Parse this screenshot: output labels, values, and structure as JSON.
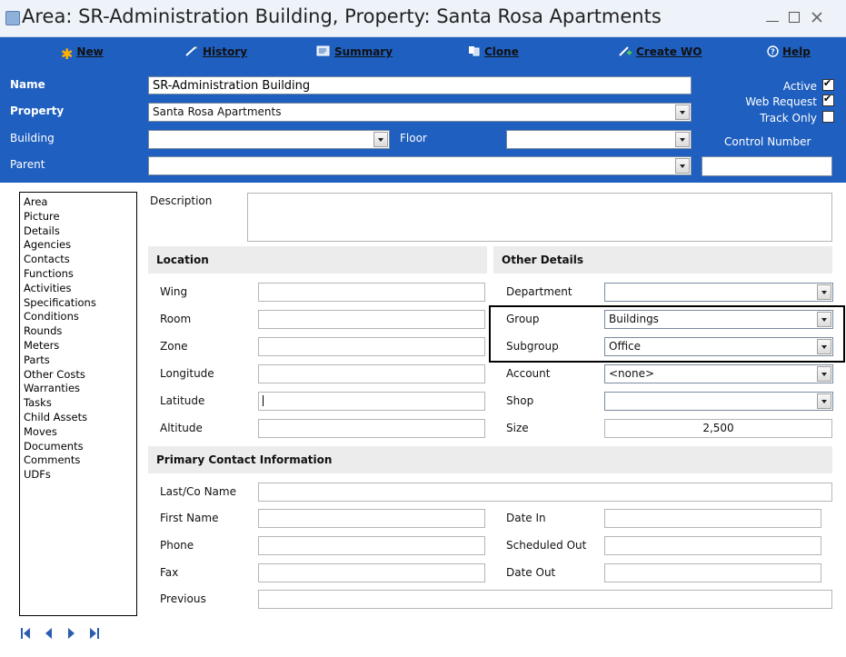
{
  "window": {
    "title": "Area:  SR-Administration Building, Property:  Santa Rosa Apartments"
  },
  "toolbar": {
    "new_label": "New",
    "history_label": "History",
    "summary_label": "Summary",
    "clone_label": "Clone",
    "create_wo_label": "Create WO",
    "help_label": "Help"
  },
  "header": {
    "name_label": "Name",
    "name_value": "SR-Administration Building",
    "property_label": "Property",
    "property_value": "Santa Rosa Apartments",
    "building_label": "Building",
    "building_value": "",
    "floor_label": "Floor",
    "floor_value": "",
    "parent_label": "Parent",
    "parent_value": "",
    "active_label": "Active",
    "active_checked": true,
    "web_request_label": "Web Request",
    "web_request_checked": true,
    "track_only_label": "Track Only",
    "track_only_checked": false,
    "control_number_label": "Control Number",
    "control_number_value": ""
  },
  "nav": {
    "items": [
      "Area",
      "Picture",
      "Details",
      "Agencies",
      "Contacts",
      "Functions",
      "Activities",
      "Specifications",
      "Conditions",
      "Rounds",
      "Meters",
      "Parts",
      "Other Costs",
      "Warranties",
      "Tasks",
      "Child Assets",
      "Moves",
      "Documents",
      "Comments",
      "UDFs"
    ]
  },
  "main": {
    "description_label": "Description",
    "description_value": "",
    "location": {
      "title": "Location",
      "wing_label": "Wing",
      "room_label": "Room",
      "zone_label": "Zone",
      "longitude_label": "Longitude",
      "latitude_label": "Latitude",
      "altitude_label": "Altitude"
    },
    "other": {
      "title": "Other Details",
      "department_label": "Department",
      "department_value": "",
      "group_label": "Group",
      "group_value": "Buildings",
      "subgroup_label": "Subgroup",
      "subgroup_value": "Office",
      "account_label": "Account",
      "account_value": "<none>",
      "shop_label": "Shop",
      "shop_value": "",
      "size_label": "Size",
      "size_value": "2,500"
    },
    "contact": {
      "title": "Primary Contact Information",
      "lastco_label": "Last/Co Name",
      "first_label": "First Name",
      "phone_label": "Phone",
      "fax_label": "Fax",
      "previous_label": "Previous",
      "date_in_label": "Date In",
      "scheduled_out_label": "Scheduled Out",
      "date_out_label": "Date Out"
    }
  },
  "colors": {
    "header_blue": "#1f5fbf",
    "section_gray": "#ececec"
  }
}
